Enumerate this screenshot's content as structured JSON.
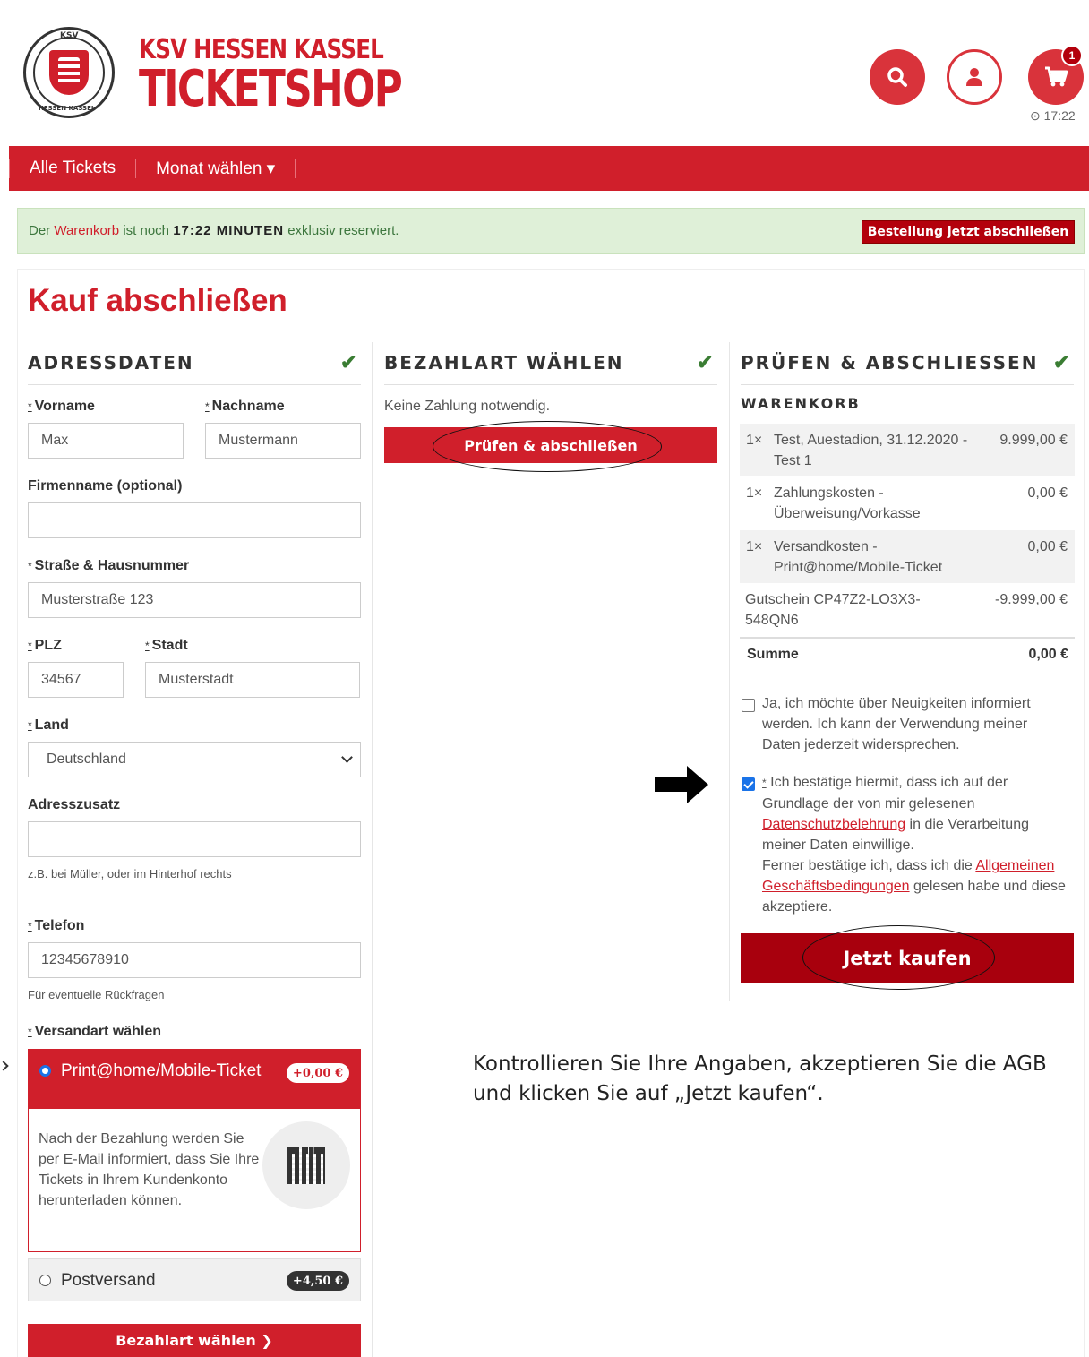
{
  "header": {
    "logo_top": "KSV",
    "logo_bottom": "HESSEN KASSEL",
    "brand_line1": "KSV HESSEN KASSEL",
    "brand_line2": "TICKETSHOP",
    "cart_count": "1",
    "cart_timer": "⊙ 17:22"
  },
  "nav": {
    "items": [
      {
        "label": "Alle Tickets"
      },
      {
        "label": "Monat wählen ▾"
      }
    ]
  },
  "reservation": {
    "prefix": "Der ",
    "cart_link": "Warenkorb",
    "middle": " ist noch ",
    "time": "17:22 MINUTEN",
    "suffix": " exklusiv reserviert.",
    "button": "Bestellung jetzt abschließen"
  },
  "page": {
    "title": "Kauf abschließen"
  },
  "address": {
    "section_title": "ADRESSDATEN",
    "req_mark": "*",
    "firstname_label": "Vorname",
    "firstname_value": "Max",
    "lastname_label": "Nachname",
    "lastname_value": "Mustermann",
    "company_label": "Firmenname (optional)",
    "company_value": "",
    "street_label": "Straße & Hausnummer",
    "street_value": "Musterstraße 123",
    "zip_label": "PLZ",
    "zip_value": "34567",
    "city_label": "Stadt",
    "city_value": "Musterstadt",
    "country_label": "Land",
    "country_value": "Deutschland",
    "addon_label": "Adresszusatz",
    "addon_value": "",
    "addon_hint": "z.B. bei Müller, oder im Hinterhof rechts",
    "phone_label": "Telefon",
    "phone_value": "12345678910",
    "phone_hint": "Für eventuelle Rückfragen",
    "shipping_label": "Versandart wählen",
    "shipping_options": [
      {
        "name": "Print@home/Mobile-Ticket",
        "price": "+0,00 €",
        "description": "Nach der Bezahlung werden Sie per E-Mail informiert, dass Sie Ihre Tickets in Ihrem Kundenkonto herunterladen können."
      },
      {
        "name": "Postversand",
        "price": "+4,50 €"
      }
    ],
    "next_button": "Bezahlart wählen ❯"
  },
  "payment": {
    "section_title": "BEZAHLART WÄHLEN",
    "info": "Keine Zahlung notwendig.",
    "button": "Prüfen & abschließen"
  },
  "review": {
    "section_title": "PRÜFEN & ABSCHLIESSEN",
    "cart_title": "WARENKORB",
    "items": [
      {
        "qty": "1×",
        "desc": "Test, Auestadion, 31.12.2020 - Test 1",
        "price": "9.999,00 €"
      },
      {
        "qty": "1×",
        "desc": "Zahlungskosten - Überweisung/Vorkasse",
        "price": "0,00 €"
      },
      {
        "qty": "1×",
        "desc": "Versandkosten - Print@home/Mobile-Ticket",
        "price": "0,00 €"
      },
      {
        "qty": "",
        "desc": "Gutschein CP47Z2-LO3X3-548QN6",
        "price": "-9.999,00 €"
      }
    ],
    "sum_label": "Summe",
    "sum_value": "0,00 €",
    "newsletter_text": "Ja, ich möchte über Neuigkeiten informiert werden. Ich kann der Verwendung meiner Daten jederzeit widersprechen.",
    "consent_req": "*",
    "consent_p1": " Ich bestätige hiermit, dass ich auf der Grundlage der von mir gelesenen ",
    "consent_link1": "Datenschutzbelehrung",
    "consent_p2": " in die Verarbeitung meiner Daten einwillige.",
    "consent_p3": "Ferner bestätige ich, dass ich die ",
    "consent_link2": "Allgemeinen Geschäftsbedingungen",
    "consent_p4": " gelesen habe und diese akzeptiere.",
    "buy_button": "Jetzt kaufen"
  },
  "instruction": "Kontrollieren Sie Ihre Angaben, akzeptieren Sie die AGB und klicken Sie auf „Jetzt kaufen“.",
  "colors": {
    "brand_red": "#d01f2b",
    "dark_red": "#b3000c",
    "success_bg": "#dff0d8",
    "check_green": "#3a7d33"
  }
}
